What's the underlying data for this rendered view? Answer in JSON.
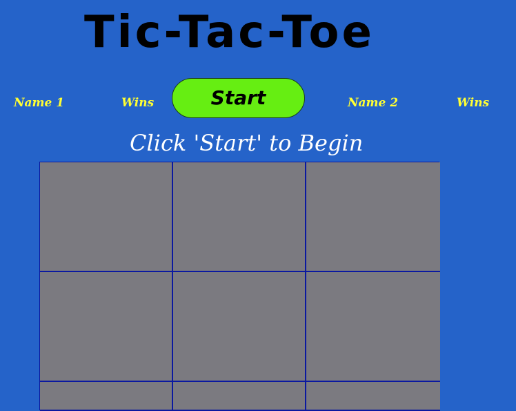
{
  "title": "Tic-Tac-Toe",
  "player1": {
    "name": "Name 1",
    "wins": "Wins"
  },
  "player2": {
    "name": "Name 2",
    "wins": "Wins"
  },
  "start_button": {
    "label": "Start"
  },
  "status": "Click 'Start' to Begin",
  "board": {
    "cells": [
      "",
      "",
      "",
      "",
      "",
      "",
      "",
      "",
      ""
    ]
  },
  "colors": {
    "background": "#2563c9",
    "cell": "#7b7a80",
    "grid_line": "#0a18a0",
    "start_button": "#66ee12",
    "player_label": "#ffff33",
    "status_text": "#ffffff",
    "title_text": "#000000"
  }
}
